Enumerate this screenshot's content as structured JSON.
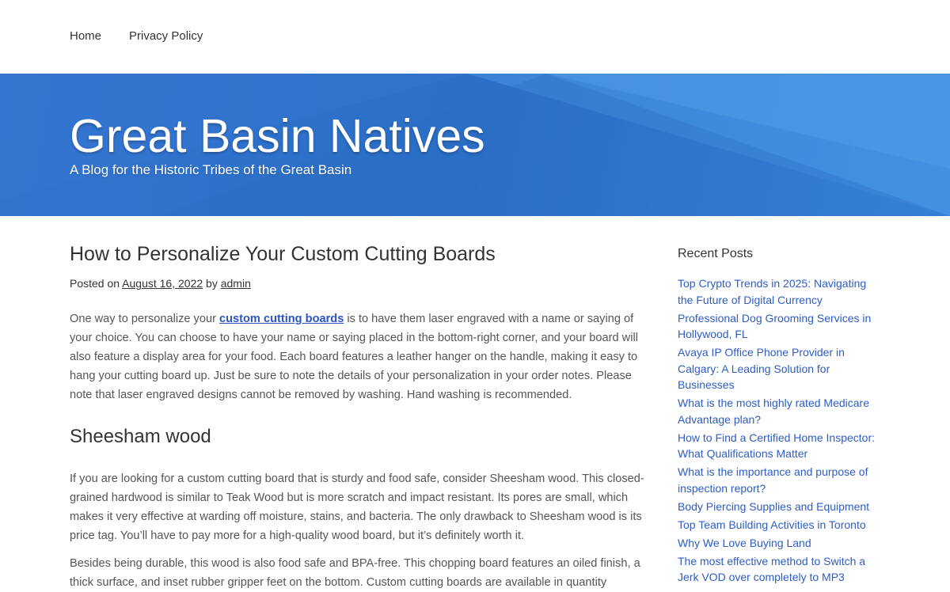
{
  "nav": {
    "home": "Home",
    "privacy": "Privacy Policy"
  },
  "header": {
    "title": "Great Basin Natives",
    "tagline": "A Blog for the Historic Tribes of the Great Basin"
  },
  "post": {
    "title": "How to Personalize Your Custom Cutting Boards",
    "meta_posted": "Posted on ",
    "date": "August 16, 2022",
    "meta_by": " by ",
    "author": "admin",
    "p1_before": "One way to personalize your ",
    "p1_link": "custom cutting boards",
    "p1_after": " is to have them laser engraved with a name or saying of your choice. You can choose to have your name or saying placed in the bottom-right corner, and your board will also feature a display area for your food. Each board features a leather hanger on the handle, making it easy to hang your cutting board up. Just be sure to note the details of your personalization in your order notes. Please note that laser engraved designs cannot be removed by washing. Hand washing is recommended.",
    "h2": "Sheesham wood",
    "p2": "If you are looking for a custom cutting board that is sturdy and food safe, consider Sheesham wood. This closed-grained hardwood is similar to Teak Wood but is more scratch and impact resistant. Its pores are small, which makes it very effective at warding off moisture, stains, and bacteria. The only drawback to Sheesham wood is its price tag. You’ll have to pay more for a high-quality wood board, but it’s definitely worth it.",
    "p3": "Besides being durable, this wood is also food safe and BPA-free. This chopping board features an oiled finish, a thick surface, and inset rubber gripper feet on the bottom. Custom cutting boards are available in quantity"
  },
  "sidebar": {
    "title": "Recent Posts",
    "posts": [
      "Top Crypto Trends in 2025: Navigating the Future of Digital Currency",
      "Professional Dog Grooming Services in Hollywood, FL",
      "Avaya IP Office Phone Provider in Calgary: A Leading Solution for Businesses",
      "What is the most highly rated Medicare Advantage plan?",
      "How to Find a Certified Home Inspector: What Qualifications Matter",
      "What is the importance and purpose of inspection report?",
      "Body Piercing Supplies and Equipment",
      "Top Team Building Activities in Toronto",
      "Why We Love Buying Land",
      "The most effective method to Switch a Jerk VOD over completely to MP3"
    ]
  },
  "colors": {
    "banner": "#2b6fc8",
    "link": "#2e5dc4",
    "inline_link": "#2b55c5",
    "text": "#333333",
    "body_text": "#555555"
  }
}
